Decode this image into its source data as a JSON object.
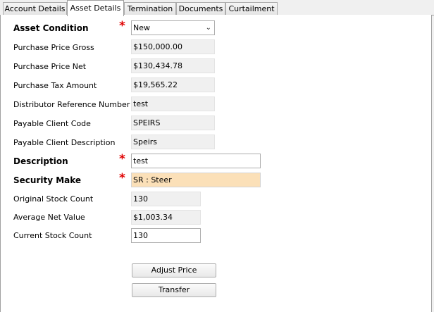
{
  "tabs": [
    {
      "label": "Account Details",
      "active": false
    },
    {
      "label": "Asset Details",
      "active": true
    },
    {
      "label": "Termination",
      "active": false
    },
    {
      "label": "Documents",
      "active": false
    },
    {
      "label": "Curtailment",
      "active": false
    }
  ],
  "required_marker": "*",
  "fields": {
    "asset_condition": {
      "label": "Asset Condition",
      "value": "New",
      "required": true
    },
    "purchase_price_gross": {
      "label": "Purchase Price Gross",
      "value": "$150,000.00"
    },
    "purchase_price_net": {
      "label": "Purchase Price Net",
      "value": "$130,434.78"
    },
    "purchase_tax_amount": {
      "label": "Purchase Tax Amount",
      "value": "$19,565.22"
    },
    "distributor_reference_number": {
      "label": "Distributor Reference Number",
      "value": "test"
    },
    "payable_client_code": {
      "label": "Payable Client Code",
      "value": "SPEIRS"
    },
    "payable_client_description": {
      "label": "Payable Client Description",
      "value": "Speirs"
    },
    "description": {
      "label": "Description",
      "value": "test",
      "required": true
    },
    "security_make": {
      "label": "Security Make",
      "value": "SR : Steer",
      "required": true
    },
    "original_stock_count": {
      "label": "Original Stock Count",
      "value": "130"
    },
    "average_net_value": {
      "label": "Average Net Value",
      "value": "$1,003.34"
    },
    "current_stock_count": {
      "label": "Current Stock Count",
      "value": "130"
    }
  },
  "buttons": {
    "adjust_price": "Adjust Price",
    "transfer": "Transfer"
  },
  "icons": {
    "dropdown": "chevron-down-icon"
  },
  "colors": {
    "required": "#e00000",
    "highlight_field": "#fbe0b8",
    "readonly_field": "#f0f0f0"
  }
}
